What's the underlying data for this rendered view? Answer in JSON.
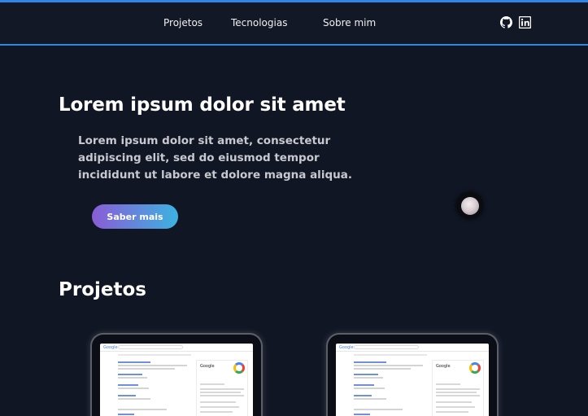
{
  "nav": {
    "items": [
      {
        "label": "Projetos"
      },
      {
        "label": "Tecnologias"
      },
      {
        "label": "Sobre mim"
      }
    ],
    "social": [
      {
        "icon": "github-icon"
      },
      {
        "icon": "linkedin-icon"
      }
    ]
  },
  "hero": {
    "title": "Lorem ipsum dolor sit amet",
    "text": "Lorem ipsum dolor sit amet, consectetur adipiscing elit, sed do eiusmod tempor incididunt ut labore et dolore magna aliqua.",
    "cta_label": "Saber mais"
  },
  "projects": {
    "title": "Projetos",
    "cards": [
      {
        "screenshot_logo": "Google",
        "panel_title": "Google"
      },
      {
        "screenshot_logo": "Google",
        "panel_title": "Google"
      }
    ]
  },
  "colors": {
    "background": "#111624",
    "accent": "#2f86e6",
    "cta_gradient_start": "#8a5cd6",
    "cta_gradient_end": "#3cb2e0"
  }
}
